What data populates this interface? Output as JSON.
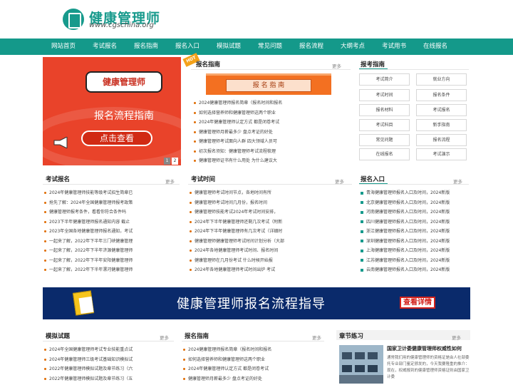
{
  "header": {
    "site_title": "健康管理师",
    "site_url": "www.cgschina.org",
    "logo_icon": "document-icon",
    "brand_color": "#179a8c"
  },
  "nav": {
    "items": [
      "网站首页",
      "考试报名",
      "报名指南",
      "报名入口",
      "模拟试题",
      "常见问题",
      "报名流程",
      "大纲考点",
      "考试用书",
      "在线报名"
    ]
  },
  "banner": {
    "heading": "健康管理师",
    "subheading": "报名流程指南",
    "button": "点击查看",
    "icon": "megaphone-icon",
    "pagination": [
      "1",
      "2"
    ],
    "bg_color": "#e9432a"
  },
  "guide_top": {
    "tag": "HOT",
    "title": "报名指南",
    "more": "更多",
    "banner_text": "报 名 指 南",
    "items": [
      "2024健康管理师报名简章（报名时间和报名",
      "如何选择营养师和健康管理师这两个职业",
      "2024年健康管理师认定方式 都是闭卷考试",
      "健康管理师月薪最多少 盘点考证的好处",
      "健康管理师考试面向人群 四大领域人员可",
      "初次报名须知：健康管理师考试流程梳理",
      "健康管理师证书有什么用处 为什么建议大"
    ]
  },
  "exam_guide": {
    "title": "报考指南",
    "buttons": [
      "考试简介",
      "就业方向",
      "考试时间",
      "报名条件",
      "报名材料",
      "考试报名",
      "考试科目",
      "新手指南",
      "常见问题",
      "报名流程",
      "在线报名",
      "考试演示"
    ]
  },
  "exam_signup": {
    "title": "考试报名",
    "more": "更多",
    "items": [
      "2024年健康管理师技能等级考试招生简章已",
      "抢先了解：2024年全国健康管理师报考政策",
      "健康管理师报考条件，看看你符合条件吗",
      "2023下半年健康管理师报名通知内容 截止",
      "2023年全国各地健康管理师报名通知，考试",
      "一起来了解，2022年下半年三门峡健康管理",
      "一起来了解，2022年下半年济源健康管理师",
      "一起来了解，2022年下半年安阳健康管理师",
      "一起来了解，2022年下半年漯河健康管理师"
    ]
  },
  "exam_time": {
    "title": "考试时间",
    "more": "更多",
    "items": [
      "健康管理师考试时间节点，各地时间有所",
      "健康管理师考试时间几月份，报名时间",
      "健康管理师技能考试2024年考试时间安排，",
      "2024年下半年健康管理师还剩几次考试（附新",
      "2024年下半年健康管理师有几次考试（详细时",
      "健康管理师健康管理师考试时间计划分析（大部",
      "2024年各地健康管理师考试时间、报名时间",
      "健康管理师在几月份考试 什么时候开始报",
      "2024年各地健康管理师考试时间出炉 考试"
    ]
  },
  "signup_entry": {
    "title": "报名入口",
    "more": "更多",
    "items": [
      "青海健康管理师报名入口及时间，2024新版",
      "北京健康管理师报名入口及时间，2024新版",
      "河南健康管理师报名入口及时间，2024新版",
      "四川健康管理师报名入口及时间，2024新版",
      "浙江健康管理师报名入口及时间，2024新版",
      "深圳健康管理师报名入口及时间，2024新版",
      "上海健康管理师报名入口及时间，2024新版",
      "江苏健康管理师报名入口及时间，2024新版",
      "云南健康管理师报名入口及时间，2024新版"
    ]
  },
  "promo": {
    "text": "健康管理师报名流程指导",
    "button": "查看详情",
    "bg_color": "#0a2a6b",
    "icon": "document-folder-icon"
  },
  "mock_exam": {
    "title": "模拟试题",
    "more": "更多",
    "items": [
      "2024年全国健康管理师考试专业技能重点试",
      "2024年健康管理师三级考试基础知识模拟试",
      "2022年健康管理师模拟试题及章节练习（六",
      "2022年健康管理师模拟试题及章节练习（五"
    ]
  },
  "guide_bottom": {
    "title": "报名指南",
    "more": "更多",
    "items": [
      "2024健康管理师报名简章（报名时间和报名",
      "如何选择营养师和健康管理师这两个职业",
      "2024年健康管理师认定方式 都是闭卷考试",
      "健康管理师月薪最多少 盘点考证的好处"
    ]
  },
  "chapter": {
    "title": "章节练习",
    "more": "更多",
    "headline": "国家卫计委健康管理师权威性如何",
    "summary": "通常我们用的健康管理师的资格证是由人社部委托专业部门鉴定颁发的，今天我要隆重的推介：现在，权威报到的健康管理师资格证则由国家卫计委"
  }
}
